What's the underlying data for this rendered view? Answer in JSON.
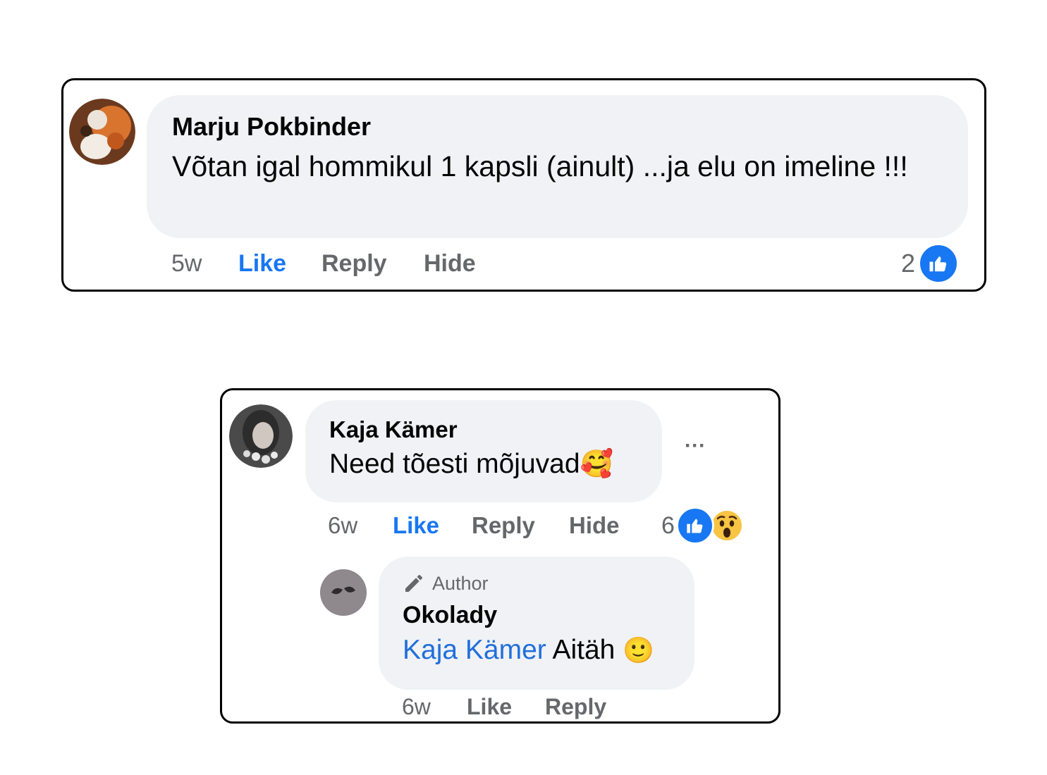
{
  "comment1": {
    "author": "Marju Pokbinder",
    "text": "Võtan igal hommikul 1 kapsli (ainult) ...ja elu on imeline !!!",
    "time": "5w",
    "like_label": "Like",
    "reply_label": "Reply",
    "hide_label": "Hide",
    "reaction_count": "2",
    "reactions": [
      "like-icon"
    ]
  },
  "comment2": {
    "author": "Kaja Kämer",
    "text": "Need tõesti mõjuvad",
    "emoji": "🥰",
    "more_label": "···",
    "time": "6w",
    "like_label": "Like",
    "reply_label": "Reply",
    "hide_label": "Hide",
    "reaction_count": "6",
    "reactions": [
      "like-icon",
      "wow-icon"
    ]
  },
  "reply": {
    "badge": "Author",
    "author": "Okolady",
    "mention": "Kaja Kämer",
    "text": "Aitäh",
    "emoji": "🙂",
    "time": "6w",
    "like_label": "Like",
    "reply_label": "Reply"
  },
  "colors": {
    "like_blue": "#1877f2",
    "bubble_bg": "#f0f2f5",
    "action_gray": "#65676b",
    "mention_blue": "#216fdb"
  }
}
